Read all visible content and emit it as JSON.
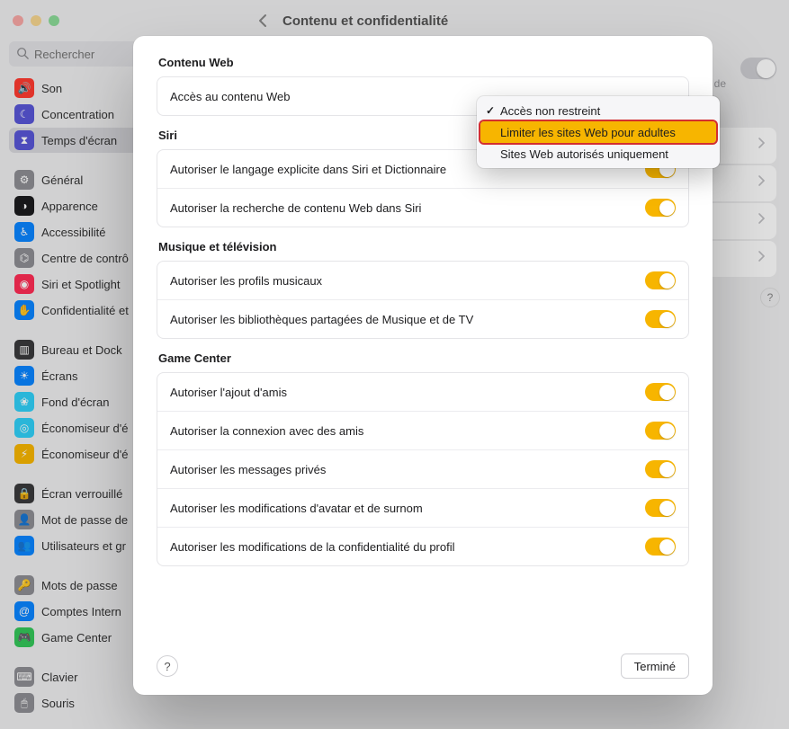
{
  "header": {
    "title": "Contenu et confidentialité"
  },
  "search": {
    "placeholder": "Rechercher"
  },
  "background": {
    "text_fragment": "réglages de"
  },
  "sidebar": {
    "items": [
      {
        "label": "Son",
        "icon_bg": "#ff3b30",
        "glyph": "🔊",
        "name": "sidebar-item-sound"
      },
      {
        "label": "Concentration",
        "icon_bg": "#5856d6",
        "glyph": "☾",
        "name": "sidebar-item-focus"
      },
      {
        "label": "Temps d'écran",
        "icon_bg": "#5856d6",
        "glyph": "⧗",
        "name": "sidebar-item-screen-time",
        "selected": true
      },
      {
        "sep": true
      },
      {
        "label": "Général",
        "icon_bg": "#8e8e93",
        "glyph": "⚙",
        "name": "sidebar-item-general"
      },
      {
        "label": "Apparence",
        "icon_bg": "#1c1c1e",
        "glyph": "◑",
        "name": "sidebar-item-appearance"
      },
      {
        "label": "Accessibilité",
        "icon_bg": "#0a84ff",
        "glyph": "♿︎",
        "name": "sidebar-item-accessibility"
      },
      {
        "label": "Centre de contrôle",
        "icon_bg": "#8e8e93",
        "glyph": "⌬",
        "name": "sidebar-item-control-center",
        "truncated": "Centre de contrô"
      },
      {
        "label": "Siri et Spotlight",
        "icon_bg": "#ff2d55",
        "glyph": "◉",
        "name": "sidebar-item-siri-spotlight"
      },
      {
        "label": "Confidentialité et sécurité",
        "icon_bg": "#0a84ff",
        "glyph": "✋",
        "name": "sidebar-item-privacy",
        "truncated": "Confidentialité et"
      },
      {
        "sep": true
      },
      {
        "label": "Bureau et Dock",
        "icon_bg": "#3a3a3c",
        "glyph": "▥",
        "name": "sidebar-item-desktop-dock"
      },
      {
        "label": "Écrans",
        "icon_bg": "#0a84ff",
        "glyph": "☀",
        "name": "sidebar-item-displays"
      },
      {
        "label": "Fond d'écran",
        "icon_bg": "#30d0f7",
        "glyph": "❀",
        "name": "sidebar-item-wallpaper"
      },
      {
        "label": "Économiseur d'écran",
        "icon_bg": "#30d0f7",
        "glyph": "◎",
        "name": "sidebar-item-screensaver",
        "truncated": "Économiseur d'é"
      },
      {
        "label": "Économiseur d'énergie",
        "icon_bg": "#f7b500",
        "glyph": "⚡︎",
        "name": "sidebar-item-energy",
        "truncated": "Économiseur d'é"
      },
      {
        "sep": true
      },
      {
        "label": "Écran verrouillé",
        "icon_bg": "#3a3a3c",
        "glyph": "🔒",
        "name": "sidebar-item-lock-screen"
      },
      {
        "label": "Mot de passe de connexion",
        "icon_bg": "#8e8e93",
        "glyph": "👤",
        "name": "sidebar-item-login-password",
        "truncated": "Mot de passe de"
      },
      {
        "label": "Utilisateurs et groupes",
        "icon_bg": "#0a84ff",
        "glyph": "👥",
        "name": "sidebar-item-users-groups",
        "truncated": "Utilisateurs et gr"
      },
      {
        "sep": true
      },
      {
        "label": "Mots de passe",
        "icon_bg": "#8e8e93",
        "glyph": "🔑",
        "name": "sidebar-item-passwords"
      },
      {
        "label": "Comptes Internet",
        "icon_bg": "#0a84ff",
        "glyph": "@",
        "name": "sidebar-item-internet-accounts",
        "truncated": "Comptes Intern"
      },
      {
        "label": "Game Center",
        "icon_bg": "#34c759",
        "glyph": "🎮",
        "name": "sidebar-item-game-center"
      },
      {
        "sep": true
      },
      {
        "label": "Clavier",
        "icon_bg": "#8e8e93",
        "glyph": "⌨",
        "name": "sidebar-item-keyboard"
      },
      {
        "label": "Souris",
        "icon_bg": "#8e8e93",
        "glyph": "🖱",
        "name": "sidebar-item-mouse"
      }
    ]
  },
  "sheet": {
    "done_label": "Terminé",
    "sections": [
      {
        "title": "Contenu Web",
        "name": "section-web-content",
        "rows": [
          {
            "label": "Accès au contenu Web",
            "toggle": null,
            "name": "row-web-content-access"
          }
        ]
      },
      {
        "title": "Siri",
        "name": "section-siri",
        "rows": [
          {
            "label": "Autoriser le langage explicite dans Siri et Dictionnaire",
            "toggle": true,
            "name": "row-siri-explicit"
          },
          {
            "label": "Autoriser la recherche de contenu Web dans Siri",
            "toggle": true,
            "name": "row-siri-web-search"
          }
        ]
      },
      {
        "title": "Musique et télévision",
        "name": "section-music-tv",
        "rows": [
          {
            "label": "Autoriser les profils musicaux",
            "toggle": true,
            "name": "row-music-profiles"
          },
          {
            "label": "Autoriser les bibliothèques partagées de Musique et de TV",
            "toggle": true,
            "name": "row-shared-libraries"
          }
        ]
      },
      {
        "title": "Game Center",
        "name": "section-game-center",
        "rows": [
          {
            "label": "Autoriser l'ajout d'amis",
            "toggle": true,
            "name": "row-gc-add-friends"
          },
          {
            "label": "Autoriser la connexion avec des amis",
            "toggle": true,
            "name": "row-gc-connect-friends"
          },
          {
            "label": "Autoriser les messages privés",
            "toggle": true,
            "name": "row-gc-private-messages"
          },
          {
            "label": "Autoriser les modifications d'avatar et de surnom",
            "toggle": true,
            "name": "row-gc-avatar-nickname"
          },
          {
            "label": "Autoriser les modifications de la confidentialité du profil",
            "toggle": true,
            "name": "row-gc-profile-privacy"
          }
        ]
      }
    ]
  },
  "dropdown": {
    "options": [
      {
        "label": "Accès non restreint",
        "checked": true,
        "highlighted": false,
        "name": "dropdown-option-unrestricted"
      },
      {
        "label": "Limiter les sites Web pour adultes",
        "checked": false,
        "highlighted": true,
        "name": "dropdown-option-limit-adult"
      },
      {
        "label": "Sites Web autorisés uniquement",
        "checked": false,
        "highlighted": false,
        "name": "dropdown-option-allowed-only"
      }
    ]
  }
}
